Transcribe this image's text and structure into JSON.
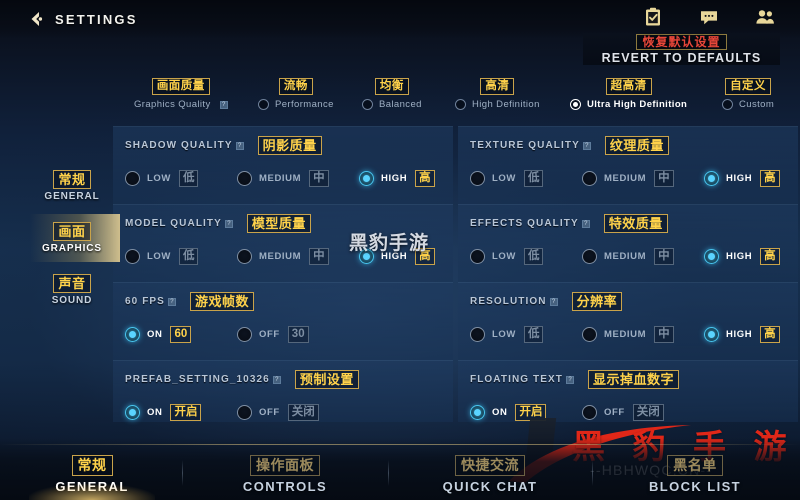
{
  "header": {
    "title": "SETTINGS",
    "back_icon": "back-arrow-icon",
    "icons": [
      {
        "name": "clipboard-check-icon"
      },
      {
        "name": "chat-bubble-icon"
      },
      {
        "name": "friends-icon"
      }
    ]
  },
  "revert": {
    "cn": "恢复默认设置",
    "en": "REVERT TO DEFAULTS"
  },
  "presets": {
    "group_cn": "画面质量",
    "group_en": "Graphics Quality",
    "options": [
      {
        "cn": "流畅",
        "en": "Performance",
        "selected": false
      },
      {
        "cn": "均衡",
        "en": "Balanced",
        "selected": false
      },
      {
        "cn": "高清",
        "en": "High Definition",
        "selected": false
      },
      {
        "cn": "超高清",
        "en": "Ultra High Definition",
        "selected": true
      },
      {
        "cn": "自定义",
        "en": "Custom",
        "selected": false
      }
    ]
  },
  "sidebar": {
    "items": [
      {
        "cn": "常规",
        "en": "GENERAL",
        "active": false
      },
      {
        "cn": "画面",
        "en": "GRAPHICS",
        "active": true
      },
      {
        "cn": "声音",
        "en": "SOUND",
        "active": false
      }
    ]
  },
  "settings": {
    "left": [
      {
        "title": "SHADOW QUALITY",
        "cn": "阴影质量",
        "options": [
          {
            "en": "LOW",
            "cn": "低",
            "selected": false
          },
          {
            "en": "MEDIUM",
            "cn": "中",
            "selected": false
          },
          {
            "en": "HIGH",
            "cn": "高",
            "selected": true
          }
        ]
      },
      {
        "title": "MODEL QUALITY",
        "cn": "模型质量",
        "options": [
          {
            "en": "LOW",
            "cn": "低",
            "selected": false
          },
          {
            "en": "MEDIUM",
            "cn": "中",
            "selected": false
          },
          {
            "en": "HIGH",
            "cn": "高",
            "selected": true
          }
        ]
      },
      {
        "title": "60 FPS",
        "cn": "游戏帧数",
        "options": [
          {
            "en": "ON",
            "cn": "60",
            "selected": true
          },
          {
            "en": "OFF",
            "cn": "30",
            "selected": false
          }
        ]
      },
      {
        "title": "PREFAB_SETTING_10326",
        "cn": "预制设置",
        "options": [
          {
            "en": "ON",
            "cn": "开启",
            "selected": true
          },
          {
            "en": "OFF",
            "cn": "关闭",
            "selected": false
          }
        ]
      }
    ],
    "right": [
      {
        "title": "TEXTURE QUALITY",
        "cn": "纹理质量",
        "options": [
          {
            "en": "LOW",
            "cn": "低",
            "selected": false
          },
          {
            "en": "MEDIUM",
            "cn": "中",
            "selected": false
          },
          {
            "en": "HIGH",
            "cn": "高",
            "selected": true
          }
        ]
      },
      {
        "title": "EFFECTS QUALITY",
        "cn": "特效质量",
        "options": [
          {
            "en": "LOW",
            "cn": "低",
            "selected": false
          },
          {
            "en": "MEDIUM",
            "cn": "中",
            "selected": false
          },
          {
            "en": "HIGH",
            "cn": "高",
            "selected": true
          }
        ]
      },
      {
        "title": "RESOLUTION",
        "cn": "分辨率",
        "options": [
          {
            "en": "LOW",
            "cn": "低",
            "selected": false
          },
          {
            "en": "MEDIUM",
            "cn": "中",
            "selected": false
          },
          {
            "en": "HIGH",
            "cn": "高",
            "selected": true
          }
        ]
      },
      {
        "title": "FLOATING TEXT",
        "cn": "显示掉血数字",
        "options": [
          {
            "en": "ON",
            "cn": "开启",
            "selected": true
          },
          {
            "en": "OFF",
            "cn": "关闭",
            "selected": false
          }
        ]
      }
    ]
  },
  "bottom_tabs": [
    {
      "cn": "常规",
      "en": "GENERAL",
      "active": true
    },
    {
      "cn": "操作面板",
      "en": "CONTROLS",
      "active": false
    },
    {
      "cn": "快捷交流",
      "en": "QUICK CHAT",
      "active": false
    },
    {
      "cn": "黑名单",
      "en": "BLOCK LIST",
      "active": false
    }
  ],
  "watermarks": {
    "gray_text": "黑豹手游",
    "red_text": "黑 豹 手 游",
    "url_text": "--HBHWQC.CN--"
  },
  "colors": {
    "gold": "#ffd24a",
    "gold_border": "#c9a34a",
    "accent_blue": "#5ad4ff",
    "red": "#e8473a",
    "panel": "#1e3a5f"
  }
}
